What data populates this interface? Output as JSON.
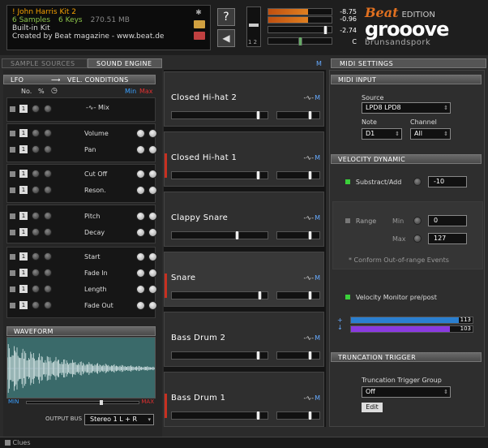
{
  "kit": {
    "name": "! John Harris Kit 2",
    "samples": "6 Samples",
    "keys": "6 Keys",
    "size": "270.51 MB",
    "type": "Built-in Kit",
    "credit": "Created by Beat magazine - www.beat.de"
  },
  "top": {
    "help": "?",
    "fader_label": "1 2",
    "meter1_val_top": "-8.75",
    "meter1_val_bot": "-0.96",
    "meter2_val": "-2.74",
    "meter3_val": "C",
    "meter1_level": 0.63,
    "meter2_level": 0.92,
    "pan_position": 0.5
  },
  "logo": {
    "beat": "Beat",
    "edition": "EDITION",
    "product": "grooove",
    "maker": "brunsandspork"
  },
  "tabs": {
    "sample_sources": "SAMPLE SOURCES",
    "sound_engine": "SOUND ENGINE",
    "midi_settings": "MIDI SETTINGS",
    "m_icon": "M"
  },
  "mod": {
    "lfo": "LFO",
    "arrow": "⟶",
    "vel_conditions": "VEL. CONDITIONS",
    "col_no": "No.",
    "col_pct": "%",
    "min": "Min",
    "max": "Max",
    "mix": "Mix",
    "params": [
      "Volume",
      "Pan",
      "Cut Off",
      "Reson.",
      "Pitch",
      "Decay",
      "Start",
      "Fade In",
      "Length",
      "Fade Out"
    ],
    "one": "1"
  },
  "waveform": {
    "header": "WAVEFORM",
    "min": "MIN",
    "max": "MAX",
    "output_bus_label": "OUTPUT BUS",
    "output_bus": "Stereo 1 L + R"
  },
  "slots": [
    {
      "name": "Closed Hi-hat 2",
      "m": "M"
    },
    {
      "name": "Closed Hi-hat 1",
      "m": "M"
    },
    {
      "name": "Clappy Snare",
      "m": "M"
    },
    {
      "name": "Snare",
      "m": "M"
    },
    {
      "name": "Bass Drum 2",
      "m": "M"
    },
    {
      "name": "Bass Drum 1",
      "m": "M"
    }
  ],
  "midi": {
    "input_header": "MIDI INPUT",
    "source_label": "Source",
    "source_value": "LPD8 LPD8",
    "note_label": "Note",
    "note_value": "D1",
    "channel_label": "Channel",
    "channel_value": "All",
    "veldyn_header": "VELOCITY DYNAMIC",
    "substract_label": "Substract/Add",
    "substract_value": "-10",
    "range_label": "Range",
    "range_min_label": "Min",
    "range_min_value": "0",
    "range_max_label": "Max",
    "range_max_value": "127",
    "conform": "* Conform Out-of-range Events",
    "velmon_label": "Velocity Monitor pre/post",
    "velmon_pre": "113",
    "velmon_post": "103",
    "trunc_header": "TRUNCATION TRIGGER",
    "trunc_group_label": "Truncation Trigger Group",
    "trunc_group_value": "Off",
    "edit": "Edit"
  },
  "status": {
    "clues": "Clues"
  },
  "colors": {
    "accent_orange": "#e07020",
    "red_marker": "#c83020",
    "vel_pre": "#2a7fd0",
    "vel_post": "#8a3ae0"
  }
}
